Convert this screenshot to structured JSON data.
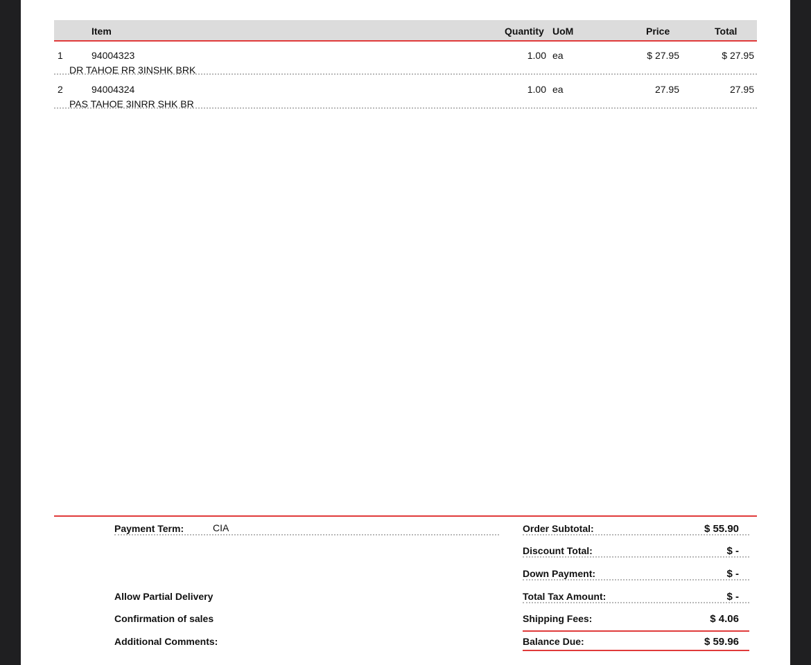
{
  "table": {
    "headers": {
      "item": "Item",
      "quantity": "Quantity",
      "uom": "UoM",
      "price": "Price",
      "total": "Total"
    },
    "rows": [
      {
        "num": "1",
        "code": "94004323",
        "description": "DR TAHOE RR 3INSHK BRK",
        "quantity": "1.00",
        "uom": "ea",
        "price": "$ 27.95",
        "total": "$ 27.95"
      },
      {
        "num": "2",
        "code": "94004324",
        "description": "PAS TAHOE 3INRR SHK BR",
        "quantity": "1.00",
        "uom": "ea",
        "price": "27.95",
        "total": "27.95"
      }
    ]
  },
  "footer": {
    "payment_term_label": "Payment Term:",
    "payment_term_value": "CIA",
    "allow_partial_delivery": "Allow Partial Delivery",
    "confirmation_of_sales": "Confirmation of sales",
    "additional_comments": "Additional Comments:"
  },
  "summary": {
    "order_subtotal_label": "Order Subtotal:",
    "order_subtotal_value": "$ 55.90",
    "discount_total_label": "Discount Total:",
    "discount_total_value": "$ -",
    "down_payment_label": "Down Payment:",
    "down_payment_value": "$ -",
    "total_tax_label": "Total Tax Amount:",
    "total_tax_value": "$ -",
    "shipping_fees_label": "Shipping Fees:",
    "shipping_fees_value": "$ 4.06",
    "balance_due_label": "Balance Due:",
    "balance_due_value": "$ 59.96"
  },
  "colors": {
    "accent_red": "#e03a3a",
    "header_gray": "#dcdcdc",
    "frame_dark": "#1f1f21"
  }
}
